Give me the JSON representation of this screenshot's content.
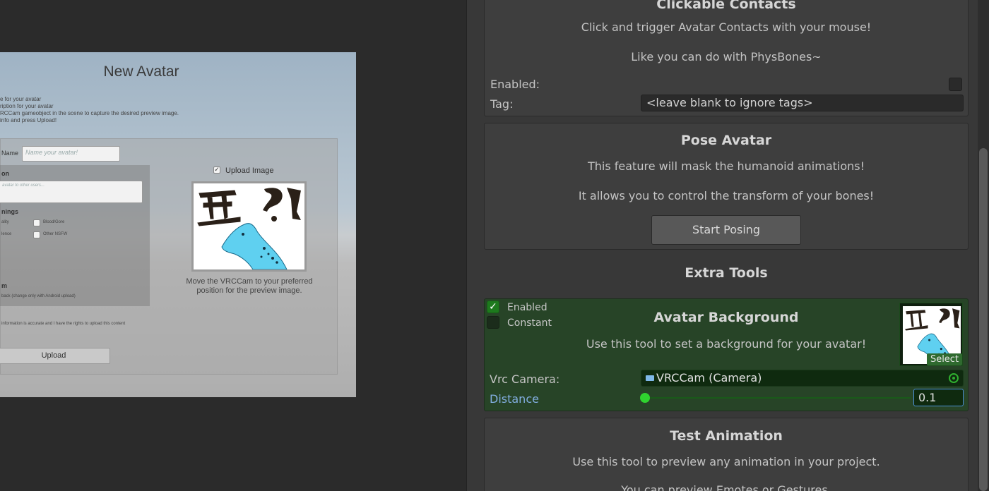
{
  "scene": {
    "title": "New Avatar",
    "instructions": [
      "e for your avatar",
      "ription for your avatar",
      "RCCam gameobject in the scene to capture the desired preview image.",
      "info and press Upload!"
    ],
    "name_label": "Name",
    "name_placeholder": "Name your avatar!",
    "description_label": "on",
    "description_placeholder": "avatar to other users...",
    "warnings_label": "nings",
    "warning_options": [
      "ality",
      "Blood/Gore",
      "lence",
      "Other NSFW"
    ],
    "platform_label": "m",
    "platform_note": "back (change only with Android upload)",
    "rights_note": "information is accurate and I have the rights to upload this content",
    "upload_label": "Upload",
    "upload_image_label": "Upload Image",
    "preview_caption": "Move the VRCCam to your preferred position for the preview image."
  },
  "inspector": {
    "clickable_contacts": {
      "title": "Clickable Contacts",
      "line1": "Click and trigger Avatar Contacts with your mouse!",
      "line2": "Like you can do with PhysBones~",
      "enabled_label": "Enabled:",
      "tag_label": "Tag:",
      "tag_value": "<leave blank to ignore tags>"
    },
    "pose_avatar": {
      "title": "Pose Avatar",
      "line1": "This feature will mask the humanoid animations!",
      "line2": "It allows you to control the transform of your bones!",
      "button": "Start Posing"
    },
    "extra_tools_title": "Extra Tools",
    "avatar_background": {
      "enabled_label": "Enabled",
      "constant_label": "Constant",
      "enabled_checked": true,
      "constant_checked": false,
      "title": "Avatar Background",
      "line1": "Use this tool to set a background for your avatar!",
      "select_label": "Select",
      "camera_label": "Vrc Camera:",
      "camera_value": "VRCCam (Camera)",
      "distance_label": "Distance",
      "distance_value": "0.1"
    },
    "test_animation": {
      "title": "Test Animation",
      "line1": "Use this tool to preview any animation in your project.",
      "line2": "You can preview Emotes or Gestures."
    }
  },
  "colors": {
    "enabled_green": "#1d7a1d",
    "section_green": "#274427",
    "link_blue": "#82aee0"
  }
}
